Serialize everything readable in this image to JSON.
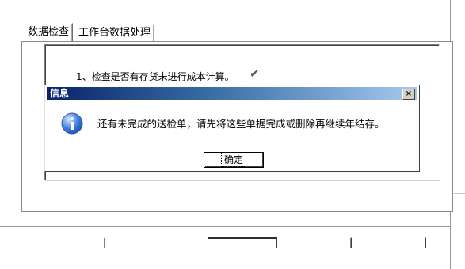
{
  "tabs": [
    {
      "label": "数据检查"
    },
    {
      "label": "工作台数据处理"
    }
  ],
  "step": {
    "text": "1、检查是否有存货未进行成本计算。",
    "mark": "✔"
  },
  "dialog": {
    "title": "信息",
    "close": "×",
    "message": "还有未完成的送检单，请先将这些单据完成或删除再继续年结存。",
    "ok_label": "确定"
  },
  "bottom_buttons": [
    "",
    "",
    "",
    ""
  ],
  "colors": {
    "titlebar_start": "#0a246a",
    "titlebar_end": "#a6caf0",
    "info_icon": "#1f5fbf"
  },
  "icons": {
    "dialog": "info-icon",
    "close": "close-icon",
    "step_status": "check-icon"
  }
}
